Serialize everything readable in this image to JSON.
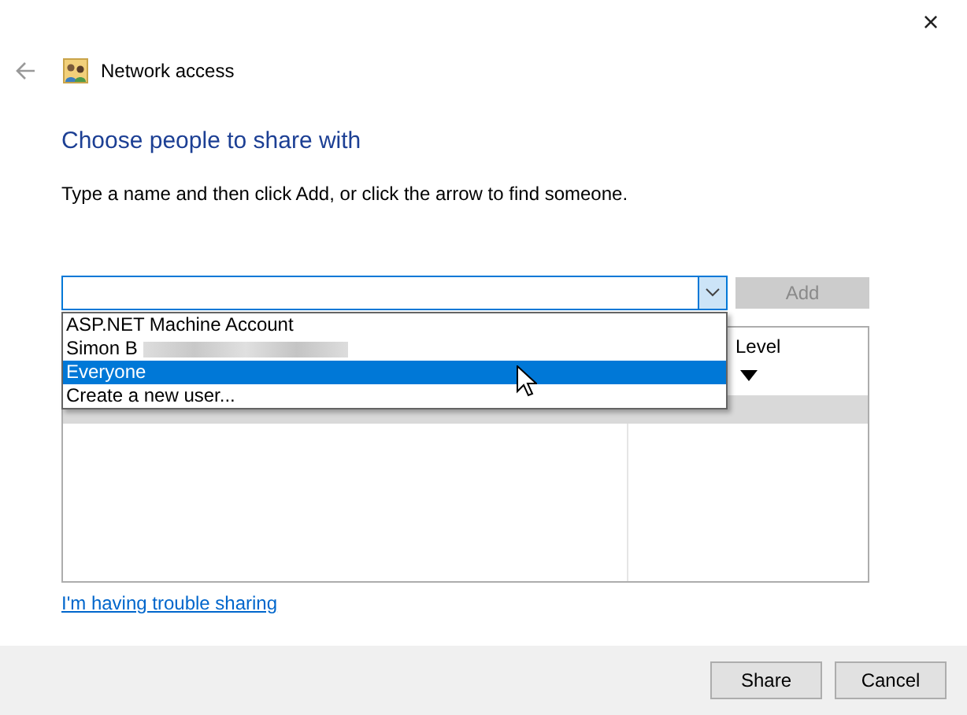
{
  "window": {
    "close": "×",
    "title": "Network access"
  },
  "heading": "Choose people to share with",
  "instruction": "Type a name and then click Add, or click the arrow to find someone.",
  "name_field": {
    "expanded": true,
    "options": [
      {
        "label": "ASP.NET Machine Account",
        "selected": false
      },
      {
        "label": "Simon B",
        "selected": false,
        "redacted": true
      },
      {
        "label": "Everyone",
        "selected": true
      },
      {
        "label": "Create a new user...",
        "selected": false
      }
    ]
  },
  "add_button": {
    "label": "Add",
    "disabled": true
  },
  "table": {
    "header": "Level",
    "rows": [
      {
        "selected": true
      }
    ]
  },
  "link": "I'm having trouble sharing",
  "buttons": [
    "Share",
    "Cancel"
  ]
}
